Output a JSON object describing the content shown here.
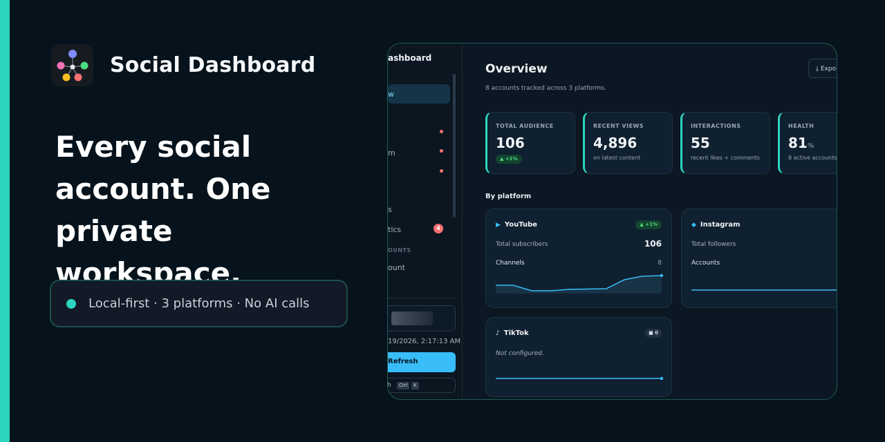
{
  "hero": {
    "brand_name": "Social Dashboard",
    "headline": "Every social account. One private workspace.",
    "pill_text": "Local-first · 3 platforms · No AI calls"
  },
  "app": {
    "sidebar": {
      "title": "ashboard",
      "active_item": "w",
      "items": [
        {
          "label": "m"
        },
        {
          "label": "s"
        },
        {
          "label": "tics"
        }
      ],
      "badge": "4",
      "section": "OUNTS",
      "account_item": "ount",
      "timestamp": "19/2026, 2:17:13 AM",
      "refresh_label": "Refresh",
      "search_label": "h",
      "kbd_ctrl": "Ctrl",
      "kbd_k": "K"
    },
    "header": {
      "title": "Overview",
      "subtitle": "8 accounts tracked across 3 platforms.",
      "export_label": "⤓ Expo"
    },
    "stats": [
      {
        "label": "TOTAL AUDIENCE",
        "value": "106",
        "chip": "▲ +1%"
      },
      {
        "label": "RECENT VIEWS",
        "value": "4,896",
        "sub": "on latest content"
      },
      {
        "label": "INTERACTIONS",
        "value": "55",
        "sub": "recent likes + comments"
      },
      {
        "label": "HEALTH",
        "value": "81",
        "unit": "%",
        "sub": "8 active accounts"
      }
    ],
    "platform_heading": "By platform",
    "platforms": {
      "youtube": {
        "icon": "▶",
        "name": "YouTube",
        "chip": "▲ +1%",
        "metric_label": "Total subscribers",
        "metric_value": "106",
        "sub_label": "Channels",
        "sub_value": "8"
      },
      "instagram": {
        "icon": "◆",
        "name": "Instagram",
        "metric_label": "Total followers",
        "sub_label": "Accounts"
      },
      "tiktok": {
        "icon": "♪",
        "name": "TikTok",
        "chip": "■ 0",
        "status": "Not configured."
      }
    },
    "colors": {
      "accent": "#2dd4bf",
      "chart": "#38bdf8",
      "alert": "#f87171"
    }
  }
}
